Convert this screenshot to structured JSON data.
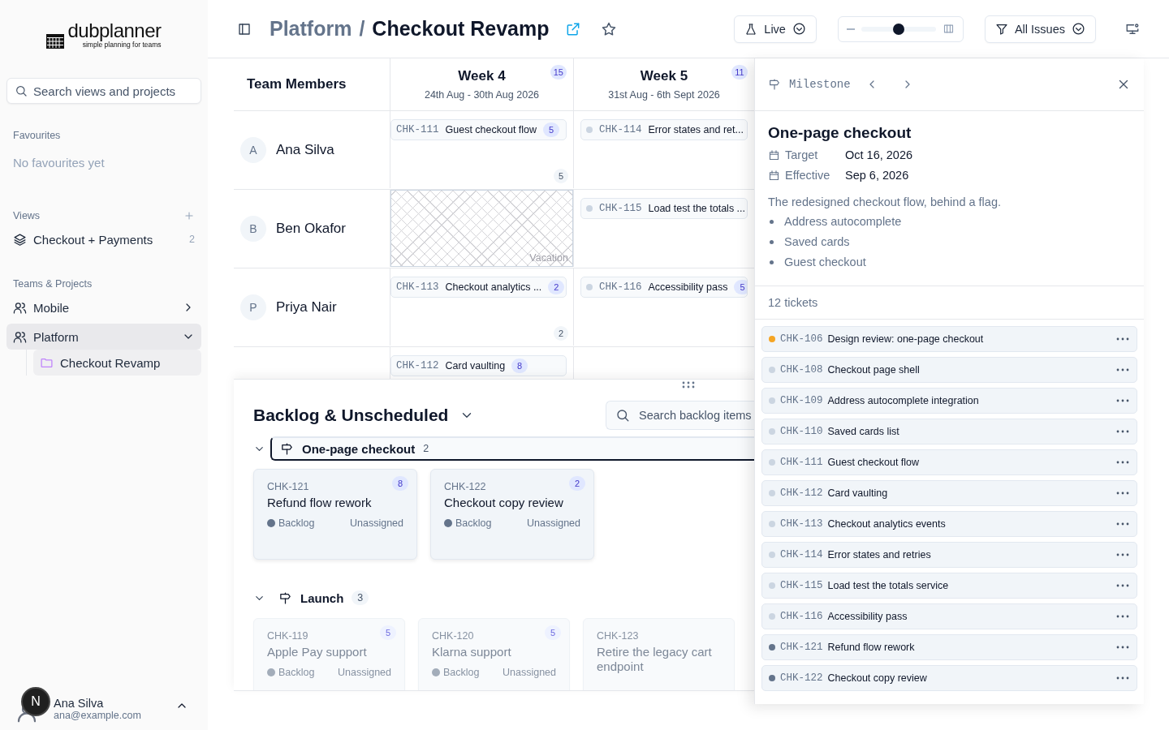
{
  "sidebar": {
    "logo": {
      "name": "dubplanner",
      "tagline": "simple planning for teams"
    },
    "search": {
      "placeholder": "Search views and projects"
    },
    "favourites": {
      "heading": "Favourites",
      "empty": "No favourites yet"
    },
    "views": {
      "heading": "Views",
      "items": [
        {
          "label": "Checkout + Payments",
          "count": "2"
        }
      ]
    },
    "teams": {
      "heading": "Teams & Projects",
      "items": [
        {
          "label": "Mobile",
          "expanded": false,
          "selected": false
        },
        {
          "label": "Platform",
          "expanded": true,
          "selected": true,
          "children": [
            {
              "label": "Checkout Revamp",
              "selected": true
            }
          ]
        }
      ]
    },
    "user": {
      "initial": "N",
      "name": "Ana Silva",
      "email": "ana@example.com"
    }
  },
  "header": {
    "breadcrumb": [
      "Platform",
      "Checkout Revamp"
    ],
    "separator": "/",
    "mode": "Live",
    "zoom": {
      "level": 0.5
    },
    "filter": "All Issues"
  },
  "board": {
    "heading": "Team Members",
    "weeks": [
      {
        "title": "Week 4",
        "range": "24th Aug - 30th Aug 2026",
        "count": "15"
      },
      {
        "title": "Week 5",
        "range": "31st Aug - 6th Sept 2026",
        "count": "11"
      }
    ],
    "rows": [
      {
        "member": {
          "initial": "A",
          "name": "Ana Silva"
        },
        "cells": [
          {
            "kind": "tickets",
            "total": "5",
            "tickets": [
              {
                "id": "CHK-111",
                "title": "Guest checkout flow",
                "points": "5"
              }
            ]
          },
          {
            "kind": "tickets",
            "tickets": [
              {
                "id": "CHK-114",
                "title": "Error states and ret...",
                "color": "#cbd5e1"
              }
            ]
          }
        ]
      },
      {
        "member": {
          "initial": "B",
          "name": "Ben Okafor"
        },
        "cells": [
          {
            "kind": "vacation",
            "label": "Vacation"
          },
          {
            "kind": "tickets",
            "tickets": [
              {
                "id": "CHK-115",
                "title": "Load test the totals ...",
                "color": "#cbd5e1"
              }
            ]
          }
        ]
      },
      {
        "member": {
          "initial": "P",
          "name": "Priya Nair"
        },
        "cells": [
          {
            "kind": "tickets",
            "total": "2",
            "tickets": [
              {
                "id": "CHK-113",
                "title": "Checkout analytics ...",
                "points": "2"
              }
            ]
          },
          {
            "kind": "tickets",
            "tickets": [
              {
                "id": "CHK-116",
                "title": "Accessibility pass",
                "points": "5",
                "color": "#cbd5e1"
              }
            ]
          }
        ]
      },
      {
        "cells": [
          {
            "kind": "tickets",
            "tickets": [
              {
                "id": "CHK-112",
                "title": "Card vaulting",
                "points": "8"
              }
            ]
          },
          {
            "kind": "empty"
          }
        ]
      }
    ]
  },
  "backlog": {
    "title": "Backlog & Unscheduled",
    "search": {
      "placeholder": "Search backlog items"
    },
    "groups": [
      {
        "name": "One-page checkout",
        "count": "2",
        "expanded": true,
        "selected": true,
        "dimmed": false,
        "cards": [
          {
            "id": "CHK-121",
            "title": "Refund flow rework",
            "points": "8",
            "status": "Backlog",
            "assignee": "Unassigned"
          },
          {
            "id": "CHK-122",
            "title": "Checkout copy review",
            "points": "2",
            "status": "Backlog",
            "assignee": "Unassigned"
          }
        ]
      },
      {
        "name": "Launch",
        "count": "3",
        "expanded": true,
        "selected": false,
        "dimmed": true,
        "cards": [
          {
            "id": "CHK-119",
            "title": "Apple Pay support",
            "points": "5",
            "status": "Backlog",
            "assignee": "Unassigned"
          },
          {
            "id": "CHK-120",
            "title": "Klarna support",
            "points": "5",
            "status": "Backlog",
            "assignee": "Unassigned"
          },
          {
            "id": "CHK-123",
            "title": "Retire the legacy cart endpoint"
          }
        ]
      }
    ]
  },
  "detail": {
    "kind_label": "Milestone",
    "title": "One-page checkout",
    "fields": [
      {
        "label": "Target",
        "value": "Oct 16, 2026"
      },
      {
        "label": "Effective",
        "value": "Sep 6, 2026"
      }
    ],
    "description": "The redesigned checkout flow, behind a flag.",
    "bullets": [
      "Address autocomplete",
      "Saved cards",
      "Guest checkout"
    ],
    "ticket_count": "12 tickets",
    "tickets": [
      {
        "id": "CHK-106",
        "title": "Design review: one-page checkout",
        "color": "#f5a524"
      },
      {
        "id": "CHK-108",
        "title": "Checkout page shell",
        "color": "#cbd5e1"
      },
      {
        "id": "CHK-109",
        "title": "Address autocomplete integration",
        "color": "#cbd5e1"
      },
      {
        "id": "CHK-110",
        "title": "Saved cards list",
        "color": "#cbd5e1"
      },
      {
        "id": "CHK-111",
        "title": "Guest checkout flow",
        "color": "#cbd5e1"
      },
      {
        "id": "CHK-112",
        "title": "Card vaulting",
        "color": "#cbd5e1"
      },
      {
        "id": "CHK-113",
        "title": "Checkout analytics events",
        "color": "#cbd5e1"
      },
      {
        "id": "CHK-114",
        "title": "Error states and retries",
        "color": "#cbd5e1"
      },
      {
        "id": "CHK-115",
        "title": "Load test the totals service",
        "color": "#cbd5e1"
      },
      {
        "id": "CHK-116",
        "title": "Accessibility pass",
        "color": "#cbd5e1"
      },
      {
        "id": "CHK-121",
        "title": "Refund flow rework",
        "color": "#64748b"
      },
      {
        "id": "CHK-122",
        "title": "Checkout copy review",
        "color": "#64748b"
      }
    ]
  }
}
